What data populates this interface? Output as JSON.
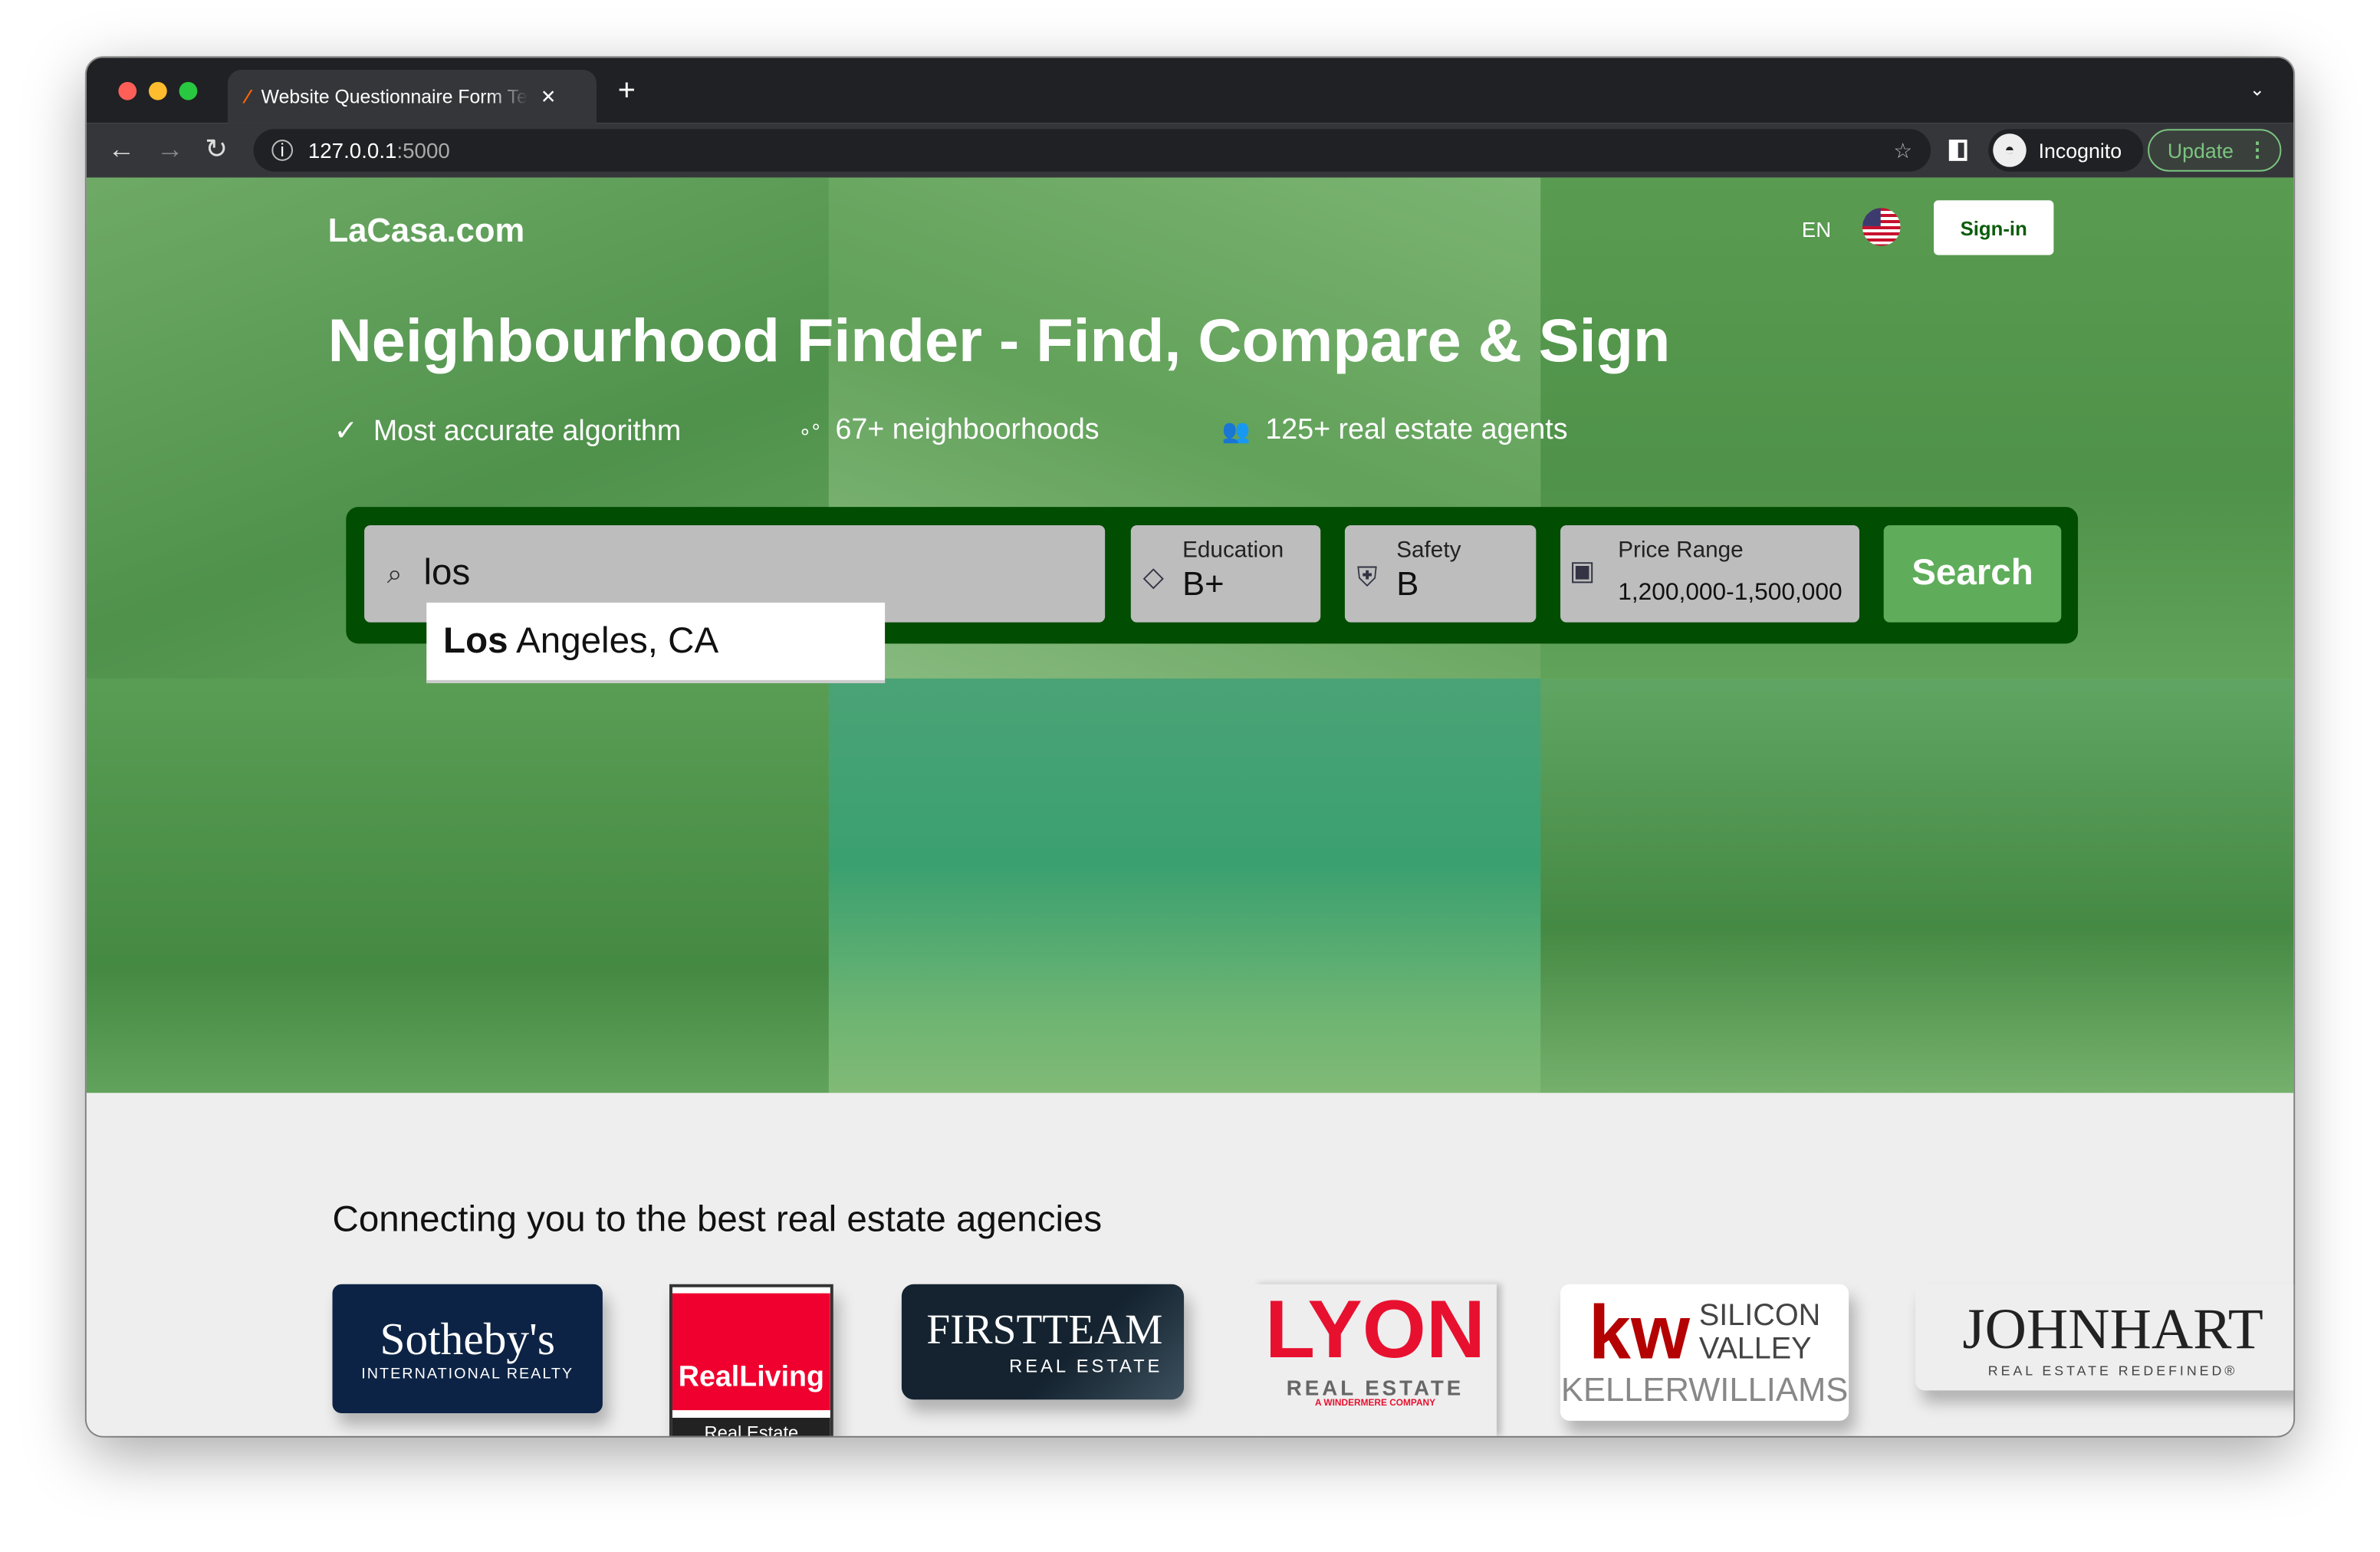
{
  "browser": {
    "tab_title": "Website Questionnaire Form Te",
    "url_host": "127.0.0.1",
    "url_port": ":5000",
    "profile": "Incognito",
    "update_label": "Update"
  },
  "header": {
    "logo": "LaCasa.com",
    "language": "EN",
    "signin_label": "Sign-in"
  },
  "hero": {
    "title": "Neighbourhood Finder - Find, Compare & Sign",
    "features": [
      {
        "icon": "check-icon",
        "text": "Most accurate algorithm"
      },
      {
        "icon": "circles-icon",
        "text": "67+ neighboorhoods"
      },
      {
        "icon": "people-icon",
        "text": "125+ real estate agents"
      }
    ]
  },
  "search": {
    "query": "los",
    "filters": [
      {
        "label": "Education",
        "value": "B+",
        "icon": "graduation-cap-icon"
      },
      {
        "label": "Safety",
        "value": "B",
        "icon": "shield-plus-icon"
      },
      {
        "label": "Price Range",
        "value": "1,200,000-1,500,000",
        "icon": "money-icon"
      }
    ],
    "button_label": "Search",
    "suggestion_match": "Los",
    "suggestion_rest": " Angeles, CA"
  },
  "agencies": {
    "heading": "Connecting you to the best real estate agencies",
    "items": [
      {
        "name": "Sotheby's",
        "sub": "INTERNATIONAL REALTY",
        "color": "#0c2345"
      },
      {
        "name": "RealLiving",
        "sub": "Real Estate",
        "color": "#f0002e"
      },
      {
        "name": "FIRSTTEAM",
        "sub": "REAL ESTATE",
        "color": "#14232f"
      },
      {
        "name": "LYON",
        "sub": "REAL ESTATE",
        "sub2": "A WINDERMERE COMPANY",
        "color": "#e8102f"
      },
      {
        "name": "kw",
        "sub": "SILICON VALLEY",
        "sub2": "KELLERWILLIAMS",
        "color": "#b40101"
      },
      {
        "name": "JOHNHART",
        "sub": "REAL ESTATE REDEFINED®",
        "color": "#222"
      }
    ]
  },
  "colors": {
    "panel": "#014d01",
    "search_button": "#5fad5a",
    "hero_tint": "#6aa865"
  }
}
